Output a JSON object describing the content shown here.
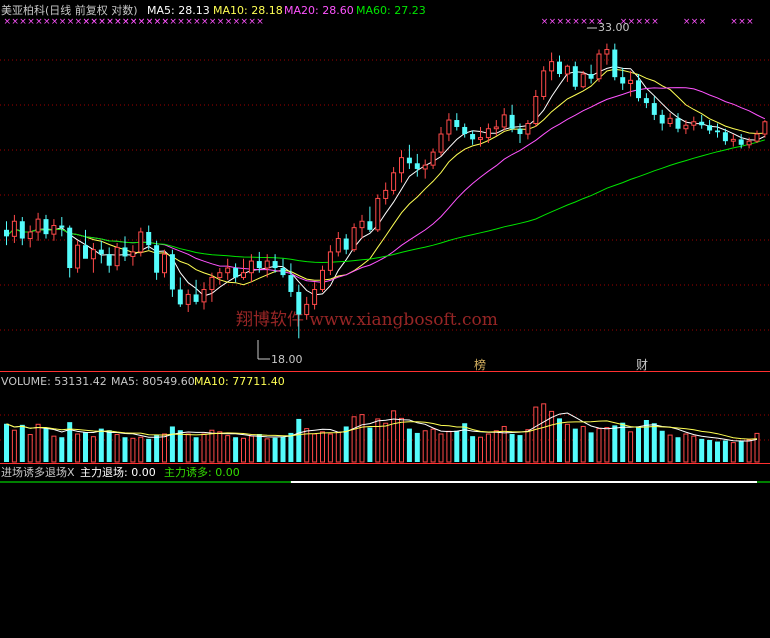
{
  "colors": {
    "background": "#000000",
    "up": "#ff4a4a",
    "down": "#54fcfc",
    "ma5": "#ffffff",
    "ma10": "#ffff54",
    "ma20": "#ff54ff",
    "ma60": "#00e600",
    "separator": "#ff3030",
    "gridline": "#a00000",
    "text": "#c8c8c8",
    "exit_line": "#ffffff",
    "lure_line": "#33dd00",
    "baseline": "#00ff00",
    "watermark": "#c83232"
  },
  "price_panel": {
    "title": "美亚柏科(日线 前复权 对数)",
    "ma5_label": "MA5: 28.13",
    "ma10_label": "MA10: 28.18",
    "ma20_label": "MA20: 28.60",
    "ma60_label": "MA60: 27.23",
    "high_label": "33.00",
    "low_label": "18.00",
    "marker_bang": "榜",
    "marker_cai": "财",
    "watermark": "翔博软件 www.xiangbosoft.com"
  },
  "volume_panel": {
    "volume_label": "VOLUME: 53131.42",
    "ma5_label": "MA5: 80549.60",
    "ma10_label": "MA10: 77711.40"
  },
  "indicator_panel": {
    "name_label": "进场诱多退场X",
    "exit_label": "主力退场: 0.00",
    "lure_label": "主力诱多: 0.00"
  },
  "chart_data": {
    "type": "candlestick",
    "price_scale": "log",
    "price_range": [
      17.5,
      34.5
    ],
    "candles": [
      [
        22.5,
        22.9,
        21.8,
        22.2
      ],
      [
        22.2,
        23.2,
        21.9,
        22.9
      ],
      [
        22.9,
        23.1,
        21.8,
        22.1
      ],
      [
        22.1,
        22.7,
        21.7,
        22.4
      ],
      [
        22.4,
        23.3,
        22.0,
        23.0
      ],
      [
        23.0,
        23.2,
        22.1,
        22.3
      ],
      [
        22.3,
        23.0,
        22.0,
        22.7
      ],
      [
        22.7,
        23.1,
        22.2,
        22.6
      ],
      [
        22.6,
        22.7,
        20.4,
        20.8
      ],
      [
        20.8,
        22.0,
        20.6,
        21.8
      ],
      [
        21.8,
        22.5,
        21.5,
        21.2
      ],
      [
        21.2,
        21.9,
        20.6,
        21.6
      ],
      [
        21.6,
        22.0,
        21.0,
        21.4
      ],
      [
        21.4,
        21.7,
        20.6,
        20.9
      ],
      [
        20.9,
        21.9,
        20.7,
        21.7
      ],
      [
        21.7,
        22.2,
        21.1,
        21.3
      ],
      [
        21.3,
        21.8,
        20.9,
        21.5
      ],
      [
        21.5,
        22.6,
        21.3,
        22.4
      ],
      [
        22.4,
        22.7,
        21.6,
        21.8
      ],
      [
        21.8,
        22.0,
        20.3,
        20.6
      ],
      [
        20.6,
        21.6,
        20.4,
        21.4
      ],
      [
        21.4,
        21.6,
        19.6,
        19.9
      ],
      [
        19.9,
        20.4,
        19.2,
        19.3
      ],
      [
        19.3,
        19.9,
        19.0,
        19.7
      ],
      [
        19.7,
        20.3,
        19.3,
        19.4
      ],
      [
        19.4,
        20.2,
        19.1,
        19.9
      ],
      [
        19.9,
        20.6,
        19.4,
        20.4
      ],
      [
        20.4,
        20.8,
        20.1,
        20.6
      ],
      [
        20.6,
        21.2,
        20.3,
        20.8
      ],
      [
        20.8,
        21.0,
        20.2,
        20.4
      ],
      [
        20.4,
        21.2,
        20.3,
        20.6
      ],
      [
        20.6,
        21.4,
        20.2,
        21.1
      ],
      [
        21.1,
        21.5,
        20.6,
        20.8
      ],
      [
        20.8,
        21.4,
        20.4,
        21.1
      ],
      [
        21.1,
        21.4,
        20.6,
        20.8
      ],
      [
        20.8,
        21.2,
        20.4,
        20.5
      ],
      [
        20.5,
        21.0,
        19.6,
        19.8
      ],
      [
        19.8,
        20.1,
        18.0,
        18.9
      ],
      [
        18.9,
        19.6,
        18.7,
        19.3
      ],
      [
        19.3,
        20.2,
        19.1,
        19.9
      ],
      [
        19.9,
        20.9,
        19.8,
        20.7
      ],
      [
        20.7,
        21.8,
        20.5,
        21.5
      ],
      [
        21.5,
        22.4,
        21.3,
        22.1
      ],
      [
        22.1,
        22.3,
        21.4,
        21.6
      ],
      [
        21.6,
        22.8,
        21.5,
        22.6
      ],
      [
        22.6,
        23.2,
        22.1,
        22.9
      ],
      [
        22.9,
        23.6,
        22.4,
        22.5
      ],
      [
        22.5,
        24.2,
        22.4,
        24.0
      ],
      [
        24.0,
        24.8,
        23.7,
        24.4
      ],
      [
        24.4,
        25.6,
        24.2,
        25.3
      ],
      [
        25.3,
        26.5,
        24.8,
        26.1
      ],
      [
        26.1,
        26.8,
        25.5,
        25.8
      ],
      [
        25.8,
        26.3,
        25.1,
        25.5
      ],
      [
        25.5,
        26.0,
        25.0,
        25.7
      ],
      [
        25.7,
        26.6,
        25.5,
        26.4
      ],
      [
        26.4,
        27.8,
        26.2,
        27.4
      ],
      [
        27.4,
        28.6,
        27.0,
        28.2
      ],
      [
        28.2,
        28.6,
        27.6,
        27.8
      ],
      [
        27.8,
        28.0,
        27.2,
        27.4
      ],
      [
        27.4,
        27.6,
        26.8,
        27.1
      ],
      [
        27.1,
        27.8,
        26.7,
        27.2
      ],
      [
        27.2,
        28.0,
        26.9,
        27.7
      ],
      [
        27.7,
        28.2,
        27.3,
        27.8
      ],
      [
        27.8,
        28.9,
        27.6,
        28.5
      ],
      [
        28.5,
        29.1,
        27.5,
        27.7
      ],
      [
        27.7,
        28.0,
        26.9,
        27.4
      ],
      [
        27.4,
        28.2,
        27.1,
        28.0
      ],
      [
        28.0,
        30.0,
        27.8,
        29.6
      ],
      [
        29.6,
        31.5,
        29.4,
        31.2
      ],
      [
        31.2,
        32.4,
        30.6,
        31.8
      ],
      [
        31.8,
        32.2,
        30.8,
        31.0
      ],
      [
        31.0,
        31.6,
        30.5,
        31.5
      ],
      [
        31.5,
        31.8,
        30.0,
        30.2
      ],
      [
        30.2,
        31.2,
        30.1,
        31.0
      ],
      [
        31.0,
        31.6,
        30.4,
        30.7
      ],
      [
        30.7,
        32.6,
        30.5,
        32.3
      ],
      [
        32.3,
        33.0,
        31.6,
        32.6
      ],
      [
        32.6,
        33.0,
        30.6,
        30.8
      ],
      [
        30.8,
        31.4,
        30.0,
        30.4
      ],
      [
        30.4,
        31.2,
        29.6,
        30.6
      ],
      [
        30.6,
        31.0,
        29.3,
        29.5
      ],
      [
        29.5,
        29.8,
        28.9,
        29.2
      ],
      [
        29.2,
        29.6,
        28.2,
        28.5
      ],
      [
        28.5,
        28.8,
        27.6,
        28.0
      ],
      [
        28.0,
        28.6,
        27.8,
        28.3
      ],
      [
        28.3,
        28.6,
        27.5,
        27.7
      ],
      [
        27.7,
        28.2,
        27.4,
        27.9
      ],
      [
        27.9,
        28.4,
        27.6,
        28.1
      ],
      [
        28.1,
        28.5,
        27.7,
        27.9
      ],
      [
        27.9,
        28.2,
        27.4,
        27.6
      ],
      [
        27.6,
        28.0,
        27.2,
        27.5
      ],
      [
        27.5,
        27.7,
        26.8,
        27.0
      ],
      [
        27.0,
        27.4,
        26.7,
        27.1
      ],
      [
        27.1,
        27.4,
        26.6,
        26.8
      ],
      [
        26.8,
        27.2,
        26.6,
        27.0
      ],
      [
        27.0,
        27.6,
        26.9,
        27.4
      ],
      [
        27.4,
        28.2,
        27.2,
        28.1
      ]
    ],
    "volume_range": [
      0,
      130000
    ],
    "volume": [
      71000,
      59000,
      69000,
      51000,
      70000,
      64000,
      48000,
      46000,
      74000,
      52000,
      55000,
      47000,
      62000,
      59000,
      51000,
      46000,
      44000,
      46000,
      43000,
      50000,
      52000,
      66000,
      59000,
      52000,
      46000,
      52000,
      59000,
      56000,
      49000,
      46000,
      44000,
      48000,
      52000,
      43000,
      45000,
      47000,
      54000,
      80000,
      62000,
      52000,
      56000,
      52000,
      55000,
      66000,
      84000,
      88000,
      64000,
      80000,
      72000,
      95000,
      81000,
      62000,
      54000,
      58000,
      61000,
      52000,
      57000,
      58000,
      72000,
      48000,
      46000,
      52000,
      58000,
      66000,
      52000,
      50000,
      60000,
      102000,
      108000,
      94000,
      81000,
      70000,
      62000,
      66000,
      55000,
      62000,
      64000,
      68000,
      73000,
      56000,
      66000,
      78000,
      72000,
      58000,
      50000,
      46000,
      52000,
      48000,
      43000,
      41000,
      38000,
      40000,
      36000,
      40000,
      41000,
      53131
    ],
    "volume_ma5": 80549.6,
    "volume_ma10": 77711.4,
    "indicator_range": [
      -1,
      0
    ],
    "exit_signal_depth": [
      0,
      0,
      0,
      0,
      0,
      0,
      0,
      0,
      0,
      0,
      0,
      0,
      0,
      0,
      0,
      0,
      0,
      0,
      0,
      0,
      0,
      0,
      0,
      0,
      0,
      0,
      0,
      0,
      0,
      0,
      0,
      0,
      0,
      0,
      0,
      0,
      0,
      0,
      0,
      0,
      0,
      0,
      0,
      0,
      0,
      0,
      0,
      0,
      0,
      0,
      0,
      0,
      0,
      0,
      0,
      0,
      0,
      0,
      0,
      0,
      0,
      0,
      0,
      0,
      0,
      0,
      0,
      0,
      0,
      0,
      0,
      0,
      0,
      0,
      0,
      0,
      0,
      0,
      0,
      0,
      0,
      0,
      0,
      0,
      0,
      0,
      0,
      0,
      0,
      0,
      0,
      0,
      0,
      0,
      0,
      0
    ],
    "lure_signal_depth": [
      0,
      0,
      0,
      0,
      0,
      0,
      0,
      0,
      0,
      0,
      0,
      0,
      0,
      0,
      0,
      0,
      0,
      0,
      0,
      0,
      0,
      0,
      0,
      0,
      0,
      0,
      0,
      0,
      0,
      0,
      0,
      0,
      0,
      0,
      0,
      0,
      0,
      0,
      0,
      0,
      0,
      0,
      0,
      0,
      0,
      0,
      0,
      0,
      0,
      0,
      0,
      0,
      0,
      0,
      0,
      0,
      0,
      0,
      0,
      0,
      0,
      0,
      0,
      0,
      0,
      0,
      0,
      0,
      0,
      0,
      0,
      0,
      0,
      0,
      0,
      0,
      0,
      0,
      0,
      0,
      0,
      0,
      0,
      0,
      0,
      0,
      0,
      0,
      0,
      0,
      0,
      0,
      0,
      0,
      0,
      0
    ]
  }
}
